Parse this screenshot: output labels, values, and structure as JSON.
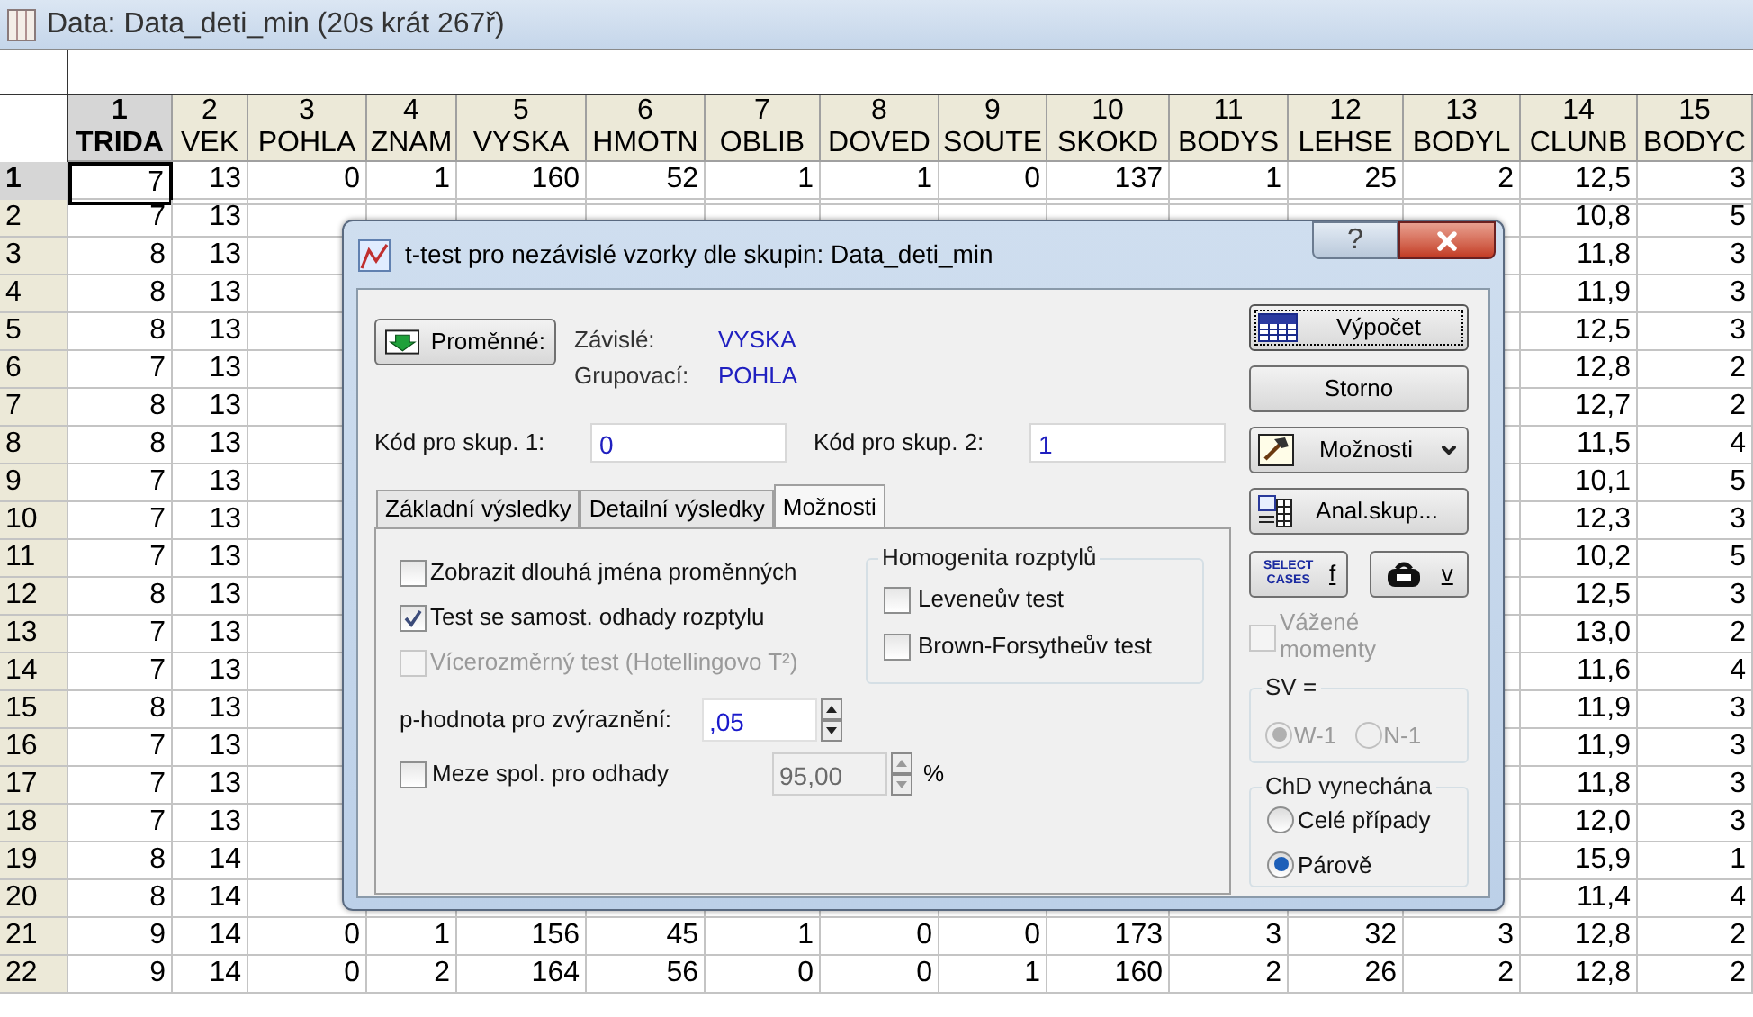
{
  "data_window": {
    "title": "Data: Data_deti_min (20s krát 267ř)",
    "columns": [
      {
        "number": "1",
        "name": "TRIDA",
        "selected": true
      },
      {
        "number": "2",
        "name": "VEK",
        "selected": false
      },
      {
        "number": "3",
        "name": "POHLA",
        "selected": false
      },
      {
        "number": "4",
        "name": "ZNAM",
        "selected": false
      },
      {
        "number": "5",
        "name": "VYSKA",
        "selected": false
      },
      {
        "number": "6",
        "name": "HMOTN",
        "selected": false
      },
      {
        "number": "7",
        "name": "OBLIB",
        "selected": false
      },
      {
        "number": "8",
        "name": "DOVED",
        "selected": false
      },
      {
        "number": "9",
        "name": "SOUTE",
        "selected": false
      },
      {
        "number": "10",
        "name": "SKOKD",
        "selected": false
      },
      {
        "number": "11",
        "name": "BODYS",
        "selected": false
      },
      {
        "number": "12",
        "name": "LEHSE",
        "selected": false
      },
      {
        "number": "13",
        "name": "BODYL",
        "selected": false
      },
      {
        "number": "14",
        "name": "CLUNB",
        "selected": false
      },
      {
        "number": "15",
        "name": "BODYC",
        "selected": false
      }
    ],
    "rows": [
      {
        "label": "1",
        "selected": true,
        "cells": [
          "7",
          "13",
          "0",
          "1",
          "160",
          "52",
          "1",
          "1",
          "0",
          "137",
          "1",
          "25",
          "2",
          "12,5",
          "3"
        ]
      },
      {
        "label": "2",
        "selected": false,
        "cells": [
          "7",
          "13",
          null,
          null,
          null,
          null,
          null,
          null,
          null,
          null,
          null,
          null,
          null,
          "10,8",
          "5"
        ]
      },
      {
        "label": "3",
        "selected": false,
        "cells": [
          "8",
          "13",
          null,
          null,
          null,
          null,
          null,
          null,
          null,
          null,
          null,
          null,
          null,
          "11,8",
          "3"
        ]
      },
      {
        "label": "4",
        "selected": false,
        "cells": [
          "8",
          "13",
          null,
          null,
          null,
          null,
          null,
          null,
          null,
          null,
          null,
          null,
          null,
          "11,9",
          "3"
        ]
      },
      {
        "label": "5",
        "selected": false,
        "cells": [
          "8",
          "13",
          null,
          null,
          null,
          null,
          null,
          null,
          null,
          null,
          null,
          null,
          null,
          "12,5",
          "3"
        ]
      },
      {
        "label": "6",
        "selected": false,
        "cells": [
          "7",
          "13",
          null,
          null,
          null,
          null,
          null,
          null,
          null,
          null,
          null,
          null,
          null,
          "12,8",
          "2"
        ]
      },
      {
        "label": "7",
        "selected": false,
        "cells": [
          "8",
          "13",
          null,
          null,
          null,
          null,
          null,
          null,
          null,
          null,
          null,
          null,
          null,
          "12,7",
          "2"
        ]
      },
      {
        "label": "8",
        "selected": false,
        "cells": [
          "8",
          "13",
          null,
          null,
          null,
          null,
          null,
          null,
          null,
          null,
          null,
          null,
          null,
          "11,5",
          "4"
        ]
      },
      {
        "label": "9",
        "selected": false,
        "cells": [
          "7",
          "13",
          null,
          null,
          null,
          null,
          null,
          null,
          null,
          null,
          null,
          null,
          null,
          "10,1",
          "5"
        ]
      },
      {
        "label": "10",
        "selected": false,
        "cells": [
          "7",
          "13",
          null,
          null,
          null,
          null,
          null,
          null,
          null,
          null,
          null,
          null,
          null,
          "12,3",
          "3"
        ]
      },
      {
        "label": "11",
        "selected": false,
        "cells": [
          "7",
          "13",
          null,
          null,
          null,
          null,
          null,
          null,
          null,
          null,
          null,
          null,
          null,
          "10,2",
          "5"
        ]
      },
      {
        "label": "12",
        "selected": false,
        "cells": [
          "8",
          "13",
          null,
          null,
          null,
          null,
          null,
          null,
          null,
          null,
          null,
          null,
          null,
          "12,5",
          "3"
        ]
      },
      {
        "label": "13",
        "selected": false,
        "cells": [
          "7",
          "13",
          null,
          null,
          null,
          null,
          null,
          null,
          null,
          null,
          null,
          null,
          null,
          "13,0",
          "2"
        ]
      },
      {
        "label": "14",
        "selected": false,
        "cells": [
          "7",
          "13",
          null,
          null,
          null,
          null,
          null,
          null,
          null,
          null,
          null,
          null,
          null,
          "11,6",
          "4"
        ]
      },
      {
        "label": "15",
        "selected": false,
        "cells": [
          "8",
          "13",
          null,
          null,
          null,
          null,
          null,
          null,
          null,
          null,
          null,
          null,
          null,
          "11,9",
          "3"
        ]
      },
      {
        "label": "16",
        "selected": false,
        "cells": [
          "7",
          "13",
          null,
          null,
          null,
          null,
          null,
          null,
          null,
          null,
          null,
          null,
          null,
          "11,9",
          "3"
        ]
      },
      {
        "label": "17",
        "selected": false,
        "cells": [
          "7",
          "13",
          null,
          null,
          null,
          null,
          null,
          null,
          null,
          null,
          null,
          null,
          null,
          "11,8",
          "3"
        ]
      },
      {
        "label": "18",
        "selected": false,
        "cells": [
          "7",
          "13",
          null,
          null,
          null,
          null,
          null,
          null,
          null,
          null,
          null,
          null,
          null,
          "12,0",
          "3"
        ]
      },
      {
        "label": "19",
        "selected": false,
        "cells": [
          "8",
          "14",
          null,
          null,
          null,
          null,
          null,
          null,
          null,
          null,
          null,
          null,
          null,
          "15,9",
          "1"
        ]
      },
      {
        "label": "20",
        "selected": false,
        "cells": [
          "8",
          "14",
          null,
          null,
          null,
          null,
          null,
          null,
          null,
          null,
          null,
          null,
          null,
          "11,4",
          "4"
        ]
      },
      {
        "label": "21",
        "selected": false,
        "cells": [
          "9",
          "14",
          "0",
          "1",
          "156",
          "45",
          "1",
          "0",
          "0",
          "173",
          "3",
          "32",
          "3",
          "12,8",
          "2"
        ]
      },
      {
        "label": "22",
        "selected": false,
        "cells": [
          "9",
          "14",
          "0",
          "2",
          "164",
          "56",
          "0",
          "0",
          "1",
          "160",
          "2",
          "26",
          "2",
          "12,8",
          "2"
        ]
      }
    ]
  },
  "dialog": {
    "title": "t-test pro nezávislé vzorky dle skupin: Data_deti_min",
    "help_button": "?",
    "variables_button": "Proměnné:",
    "variables": [
      {
        "label": "Závislé:",
        "value": "VYSKA"
      },
      {
        "label": "Grupovací:",
        "value": "POHLA"
      }
    ],
    "codes": [
      {
        "label": "Kód pro skup. 1:",
        "value": "0"
      },
      {
        "label": "Kód pro skup. 2:",
        "value": "1"
      }
    ],
    "tabs": [
      {
        "label": "Základní výsledky",
        "selected": false
      },
      {
        "label": "Detailní výsledky",
        "selected": false
      },
      {
        "label": "Možnosti",
        "selected": true
      }
    ],
    "options": [
      {
        "label": "Zobrazit dlouhá jména proměnných",
        "checked": false,
        "disabled": false
      },
      {
        "label": "Test se samost. odhady rozptylu",
        "checked": true,
        "disabled": false
      },
      {
        "label": "Vícerozměrný test (Hotellingovo T²)",
        "checked": false,
        "disabled": true
      }
    ],
    "homogeneity": {
      "title": "Homogenita rozptylů",
      "items": [
        {
          "label": "Leveneův test",
          "checked": false
        },
        {
          "label": "Brown-Forsytheův test",
          "checked": false
        }
      ]
    },
    "p_value": {
      "label": "p-hodnota pro zvýraznění:",
      "value": ",05"
    },
    "confidence": {
      "label": "Meze spol. pro odhady",
      "checked": false,
      "value": "95,00",
      "unit": "%"
    },
    "actions": [
      {
        "label": "Výpočet",
        "kind": "compute"
      },
      {
        "label": "Storno",
        "kind": "plain"
      },
      {
        "label": "Možnosti",
        "kind": "dropdown"
      },
      {
        "label": "Anal.skup...",
        "kind": "groups"
      }
    ],
    "small_buttons": [
      {
        "label": "f",
        "kind": "select",
        "icon_text": "SELECT CASES"
      },
      {
        "label": "v",
        "kind": "weight"
      }
    ],
    "weighted": {
      "label": "Vážené momenty",
      "checked": false,
      "disabled": true
    },
    "df": {
      "title": "SV =",
      "disabled": true,
      "options": [
        {
          "label": "W-1",
          "selected": true
        },
        {
          "label": "N-1",
          "selected": false
        }
      ]
    },
    "missing": {
      "title": "ChD vynechána",
      "options": [
        {
          "label": "Celé případy",
          "selected": false
        },
        {
          "label": "Párově",
          "selected": true
        }
      ]
    }
  }
}
